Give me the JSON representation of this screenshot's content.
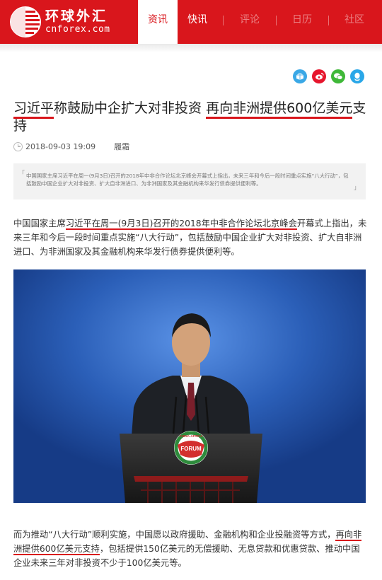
{
  "header": {
    "logo_cn": "环球外汇",
    "logo_en": "cnforex.com",
    "tabs": [
      {
        "label": "资讯",
        "state": "active"
      },
      {
        "label": "快讯",
        "state": "normal"
      },
      {
        "label": "评论",
        "state": "faded"
      },
      {
        "label": "日历",
        "state": "faded"
      },
      {
        "label": "社区",
        "state": "faded"
      }
    ]
  },
  "share": {
    "icons": [
      "qzone-icon",
      "weibo-icon",
      "wechat-icon",
      "qq-icon"
    ],
    "colors": [
      "#3aa8e6",
      "#e6162d",
      "#3fb838",
      "#2aa7e8"
    ]
  },
  "article": {
    "title_part1": "习近平",
    "title_part2": "称鼓励中企扩大对非投资 ",
    "title_part3": "再向非洲提供600亿美元",
    "title_part4": "支持",
    "datetime": "2018-09-03 19:09",
    "author": "履霜",
    "summary": "中国国家主席习近平在周一(9月3日)召开的2018年中非合作论坛北京峰会开幕式上指出，未来三年和今后一段时间重点实施“八大行动”，包括鼓励中国企业扩大对非投资、扩大自非洲进口、为非洲国家及其金融机构来华发行债券提供便利等。",
    "p1_a": "中国国家主席",
    "p1_b": "习近平在周一(9月3日)召开的2018年中非合作论坛北京峰会",
    "p1_c": "开幕式上指出，未来三年和今后一段时间重点实施“八大行动”，包括鼓励中国企业扩大对非投资、扩大自非洲进口、为非洲国家及其金融机构来华发行债券提供便利等。",
    "p2_a": "而为推动“八大行动”顺利实施，中国愿以政府援助、金融机构和企业投融资等方式，",
    "p2_b": "再向非洲提供600亿美元支持",
    "p2_c": "，包括提供150亿美元的无偿援助、无息贷款和优惠贷款、推动中国企业未来三年对非投资不少于100亿美元等。",
    "photo": {
      "podium_sign": "FORUM",
      "podium_arc": "CHINA-AFRICA"
    }
  },
  "colors": {
    "brand_red": "#d9161c",
    "photo_blue": "#2457ae"
  }
}
